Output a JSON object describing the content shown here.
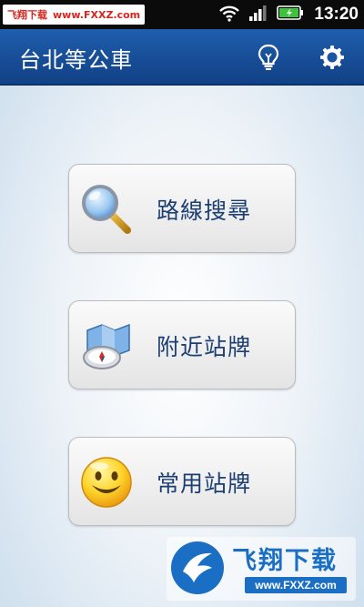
{
  "status_bar": {
    "watermark_site": "飞翔下载",
    "watermark_url": "www.FXXZ.com",
    "time": "13:20",
    "icons": [
      "wifi-icon",
      "signal-icon",
      "battery-icon"
    ]
  },
  "app_bar": {
    "title": "台北等公車",
    "actions": [
      "lightbulb-icon",
      "settings-icon"
    ],
    "color": "#1a56a0"
  },
  "menu": [
    {
      "label": "路線搜尋",
      "icon": "magnifier-icon"
    },
    {
      "label": "附近站牌",
      "icon": "map-compass-icon"
    },
    {
      "label": "常用站牌",
      "icon": "smiley-icon"
    }
  ],
  "watermark_bottom": {
    "brand": "飞翔下载",
    "domain": "www.FXXZ.com"
  }
}
